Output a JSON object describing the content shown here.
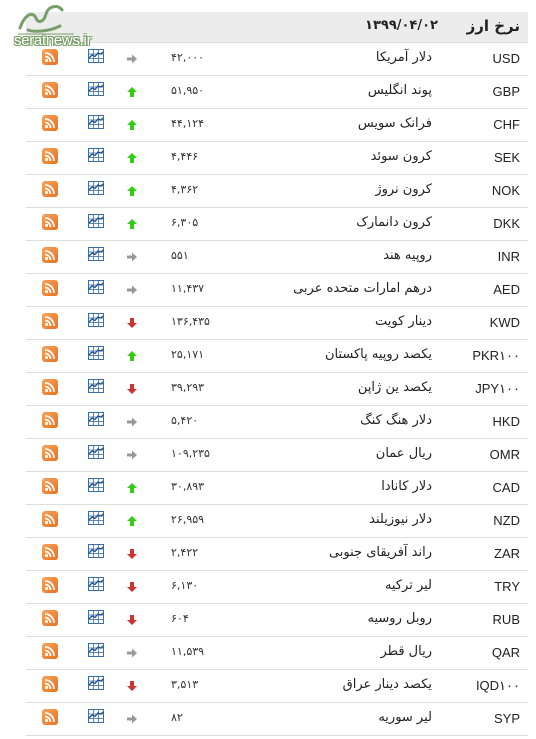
{
  "logo": {
    "text": "seratnews.ir",
    "brand_color": "#7a9e6a"
  },
  "header": {
    "title": "نرخ ارز",
    "date": "۱۳۹۹/۰۴/۰۲"
  },
  "colors": {
    "up": "#33cc11",
    "down": "#cc3333",
    "neutral": "#999999",
    "rss": "#e8711f",
    "chart": "#3a6ea5"
  },
  "rows": [
    {
      "code": "USD",
      "name": "دلار آمریکا",
      "price": "۴۲,۰۰۰",
      "trend": "neutral"
    },
    {
      "code": "GBP",
      "name": "پوند انگلیس",
      "price": "۵۱,۹۵۰",
      "trend": "up"
    },
    {
      "code": "CHF",
      "name": "فرانک سویس",
      "price": "۴۴,۱۲۴",
      "trend": "up"
    },
    {
      "code": "SEK",
      "name": "کرون سوئد",
      "price": "۴,۴۴۶",
      "trend": "up"
    },
    {
      "code": "NOK",
      "name": "کرون نروژ",
      "price": "۴,۳۶۲",
      "trend": "up"
    },
    {
      "code": "DKK",
      "name": "کرون دانمارک",
      "price": "۶,۳۰۵",
      "trend": "up"
    },
    {
      "code": "INR",
      "name": "روپیه هند",
      "price": "۵۵۱",
      "trend": "neutral"
    },
    {
      "code": "AED",
      "name": "درهم امارات متحده عربی",
      "price": "۱۱,۴۳۷",
      "trend": "neutral"
    },
    {
      "code": "KWD",
      "name": "دینار کویت",
      "price": "۱۳۶,۴۳۵",
      "trend": "down"
    },
    {
      "code": "PKR۱۰۰",
      "name": "یکصد روپیه پاکستان",
      "price": "۲۵,۱۷۱",
      "trend": "up"
    },
    {
      "code": "JPY۱۰۰",
      "name": "یکصد ین ژاپن",
      "price": "۳۹,۲۹۳",
      "trend": "down"
    },
    {
      "code": "HKD",
      "name": "دلار هنگ کنگ",
      "price": "۵,۴۲۰",
      "trend": "neutral"
    },
    {
      "code": "OMR",
      "name": "ریال عمان",
      "price": "۱۰۹,۲۳۵",
      "trend": "neutral"
    },
    {
      "code": "CAD",
      "name": "دلار کانادا",
      "price": "۳۰,۸۹۳",
      "trend": "up"
    },
    {
      "code": "NZD",
      "name": "دلار نیوزیلند",
      "price": "۲۶,۹۵۹",
      "trend": "up"
    },
    {
      "code": "ZAR",
      "name": "راند آفریقای جنوبی",
      "price": "۲,۴۲۲",
      "trend": "down"
    },
    {
      "code": "TRY",
      "name": "لیر ترکیه",
      "price": "۶,۱۳۰",
      "trend": "down"
    },
    {
      "code": "RUB",
      "name": "روبل روسیه",
      "price": "۶۰۴",
      "trend": "down"
    },
    {
      "code": "QAR",
      "name": "ریال قطر",
      "price": "۱۱,۵۳۹",
      "trend": "neutral"
    },
    {
      "code": "IQD۱۰۰",
      "name": "یکصد دینار عراق",
      "price": "۳,۵۱۳",
      "trend": "down"
    },
    {
      "code": "SYP",
      "name": "لیر سوریه",
      "price": "۸۲",
      "trend": "neutral"
    }
  ]
}
